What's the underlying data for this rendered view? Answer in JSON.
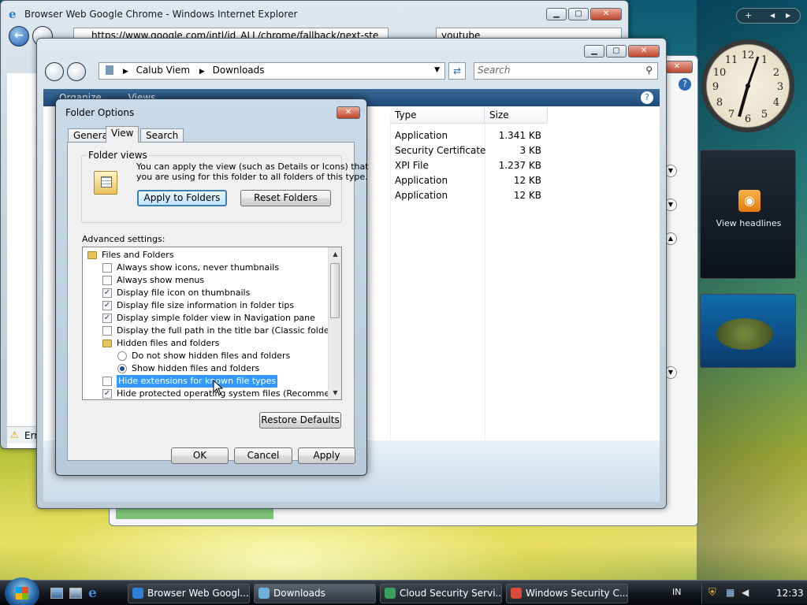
{
  "ie": {
    "title": "Browser Web Google Chrome - Windows Internet Explorer",
    "address": "https://www.google.com/intl/id_ALL/chrome/fallback/next-ste",
    "search_value": "youtube",
    "status": "Err"
  },
  "explorer": {
    "path_root": "Calub Viem",
    "path_leaf": "Downloads",
    "search_placeholder": "Search",
    "toolbar_organize": "Organize",
    "toolbar_views": "Views",
    "columns": {
      "type": "Type",
      "size": "Size"
    },
    "files": [
      {
        "type": "Application",
        "size": "1.341 KB"
      },
      {
        "type": "Security Certificate",
        "size": "3 KB"
      },
      {
        "type": "XPI File",
        "size": "1.237 KB"
      },
      {
        "type": "Application",
        "size": "12 KB"
      },
      {
        "type": "Application",
        "size": "12 KB"
      }
    ]
  },
  "dialog": {
    "title": "Folder Options",
    "tabs": [
      "General",
      "View",
      "Search"
    ],
    "active_tab": "View",
    "folder_views_label": "Folder views",
    "folder_views_text_1": "You can apply the view (such as Details or Icons) that",
    "folder_views_text_2": "you are using for this folder to all folders of this type.",
    "apply_to_folders": "Apply to Folders",
    "reset_folders": "Reset Folders",
    "advanced_label": "Advanced settings:",
    "tree": [
      {
        "kind": "folder",
        "indent": 0,
        "label": "Files and Folders"
      },
      {
        "kind": "check",
        "indent": 1,
        "label": "Always show icons, never thumbnails",
        "checked": false
      },
      {
        "kind": "check",
        "indent": 1,
        "label": "Always show menus",
        "checked": false
      },
      {
        "kind": "check",
        "indent": 1,
        "label": "Display file icon on thumbnails",
        "checked": true
      },
      {
        "kind": "check",
        "indent": 1,
        "label": "Display file size information in folder tips",
        "checked": true
      },
      {
        "kind": "check",
        "indent": 1,
        "label": "Display simple folder view in Navigation pane",
        "checked": true
      },
      {
        "kind": "check",
        "indent": 1,
        "label": "Display the full path in the title bar (Classic folders only)",
        "checked": false
      },
      {
        "kind": "folder",
        "indent": 1,
        "label": "Hidden files and folders"
      },
      {
        "kind": "radio",
        "indent": 2,
        "label": "Do not show hidden files and folders",
        "checked": false
      },
      {
        "kind": "radio",
        "indent": 2,
        "label": "Show hidden files and folders",
        "checked": true
      },
      {
        "kind": "check",
        "indent": 1,
        "label": "Hide extensions for known file types",
        "checked": false,
        "selected": true
      },
      {
        "kind": "check",
        "indent": 1,
        "label": "Hide protected operating system files (Recommended)",
        "checked": true
      }
    ],
    "restore_defaults": "Restore Defaults",
    "ok": "OK",
    "cancel": "Cancel",
    "apply": "Apply"
  },
  "sidebar": {
    "feed_label": "View headlines"
  },
  "taskbar": {
    "items": [
      {
        "label": "Browser Web Googl...",
        "color": "#2f7fd8"
      },
      {
        "label": "Downloads",
        "color": "#6fb0d8"
      },
      {
        "label": "Cloud Security Servi...",
        "color": "#3aa060"
      },
      {
        "label": "Windows Security C...",
        "color": "#d84a3a"
      }
    ],
    "lang": "IN",
    "clock": "12:33"
  }
}
